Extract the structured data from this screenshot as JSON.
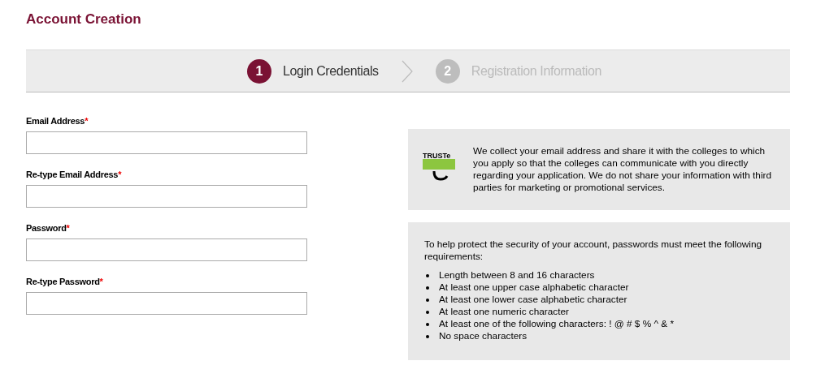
{
  "page_title": "Account Creation",
  "steps": [
    {
      "number": "1",
      "label": "Login Credentials",
      "selected": true
    },
    {
      "number": "2",
      "label": "Registration Information",
      "selected": false
    }
  ],
  "fields": [
    {
      "label": "Email Address",
      "marker": "*"
    },
    {
      "label": "Re-type Email Address",
      "marker": "*"
    },
    {
      "label": "Password",
      "marker": "*"
    },
    {
      "label": "Re-type Password",
      "marker": "*"
    }
  ],
  "privacy_panel": {
    "logo": "TRUSTe",
    "text": "We collect your email address and share it with the colleges to which you apply so that the colleges can communicate with you directly regarding your application. We do not share your information with third parties for marketing or promotional services."
  },
  "password_panel": {
    "intro": "To help protect the security of your account, passwords must meet the following requirements:",
    "requirements": [
      "Length between 8 and 16 characters",
      "At least one upper case alphabetic character",
      "At least one lower case alphabetic character",
      "At least one numeric character",
      "At least one of the following characters: ! @ # $ % ^ & *",
      "No space characters"
    ]
  }
}
